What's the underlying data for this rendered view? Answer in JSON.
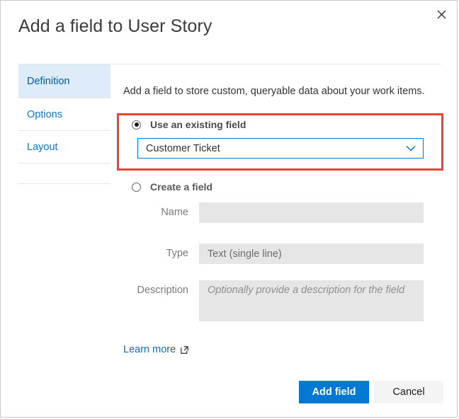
{
  "dialog": {
    "title": "Add a field to User Story",
    "close_icon": "close-icon"
  },
  "tabs": [
    {
      "label": "Definition",
      "selected": true
    },
    {
      "label": "Options",
      "selected": false
    },
    {
      "label": "Layout",
      "selected": false
    }
  ],
  "panel": {
    "intro": "Add a field to store custom, queryable data about your work items.",
    "existing": {
      "radio_label": "Use an existing field",
      "selected": true,
      "dropdown_value": "Customer Ticket",
      "dropdown_icon": "chevron-down-icon"
    },
    "create": {
      "radio_label": "Create a field",
      "selected": false,
      "name_label": "Name",
      "name_value": "",
      "type_label": "Type",
      "type_value": "Text (single line)",
      "description_label": "Description",
      "description_placeholder": "Optionally provide a description for the field"
    },
    "learn_more": {
      "label": "Learn more",
      "icon": "external-link-icon"
    }
  },
  "footer": {
    "primary_label": "Add field",
    "secondary_label": "Cancel"
  },
  "annotation": {
    "color": "#e8432e"
  },
  "colors": {
    "accent": "#0078d4",
    "tab_selected_bg": "#deecf9",
    "disabled_field_bg": "#e6e6e6",
    "highlight": "#e8432e"
  }
}
